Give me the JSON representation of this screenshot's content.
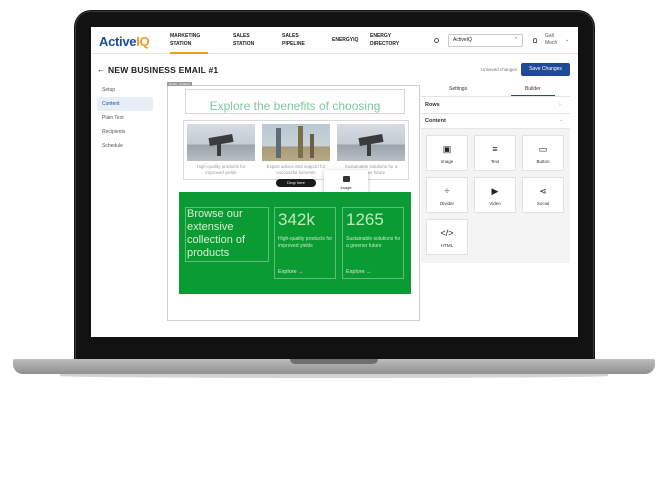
{
  "app": {
    "logo_part1": "Active",
    "logo_part2": "IQ",
    "nav": [
      {
        "label_line1": "MARKETING",
        "label_line2": "STATION",
        "active": true
      },
      {
        "label_line1": "SALES",
        "label_line2": "STATION",
        "active": false
      },
      {
        "label_line1": "SALES",
        "label_line2": "PIPELINE",
        "active": false
      },
      {
        "label_line1": "ENERGYIQ",
        "label_line2": "",
        "active": false
      },
      {
        "label_line1": "ENERGY",
        "label_line2": "DIRECTORY",
        "active": false
      }
    ],
    "account_select": "ActiveIQ",
    "user_name_line1": "Gail",
    "user_name_line2": "Moch"
  },
  "header": {
    "title": "NEW BUSINESS EMAIL #1",
    "saved_status": "Unsaved changes",
    "save_label": "Save Changes"
  },
  "steps": [
    "Setup",
    "Content",
    "Plain Text",
    "Recipients",
    "Schedule"
  ],
  "active_step": "Content",
  "canvas": {
    "tag": "Email · Content",
    "hero_title": "Explore the benefits of choosing",
    "cards": [
      {
        "text": "High-quality products for improved yields"
      },
      {
        "text": "Expert advice and support for successful harvests"
      },
      {
        "text": "Sustainable solutions for a greener future"
      }
    ],
    "drop_here": "Drop here",
    "drag_label": "Image",
    "green": {
      "heading": "Browse our extensive collection of products",
      "stat1": "342k",
      "stat1_text": "High-quality products for improved yields",
      "stat2": "1265",
      "stat2_text": "Sustainable solutions for a greener future",
      "link1": "Explore →",
      "link2": "Explore →"
    }
  },
  "panel": {
    "tabs": [
      "Settings",
      "Builder"
    ],
    "active_tab": "Builder",
    "section_rows": "Rows",
    "section_content": "Content",
    "blocks": [
      {
        "label": "Image",
        "icon": "image-icon"
      },
      {
        "label": "Text",
        "icon": "text-icon"
      },
      {
        "label": "Button",
        "icon": "button-icon"
      },
      {
        "label": "Divider",
        "icon": "divider-icon"
      },
      {
        "label": "Video",
        "icon": "video-icon"
      },
      {
        "label": "Social",
        "icon": "share-icon"
      },
      {
        "label": "HTML",
        "icon": "code-icon"
      }
    ]
  },
  "colors": {
    "brand_blue": "#1f4a9a",
    "brand_orange": "#f39a1e",
    "green_block": "#0a9b35",
    "hero_text": "#7fc79c"
  }
}
